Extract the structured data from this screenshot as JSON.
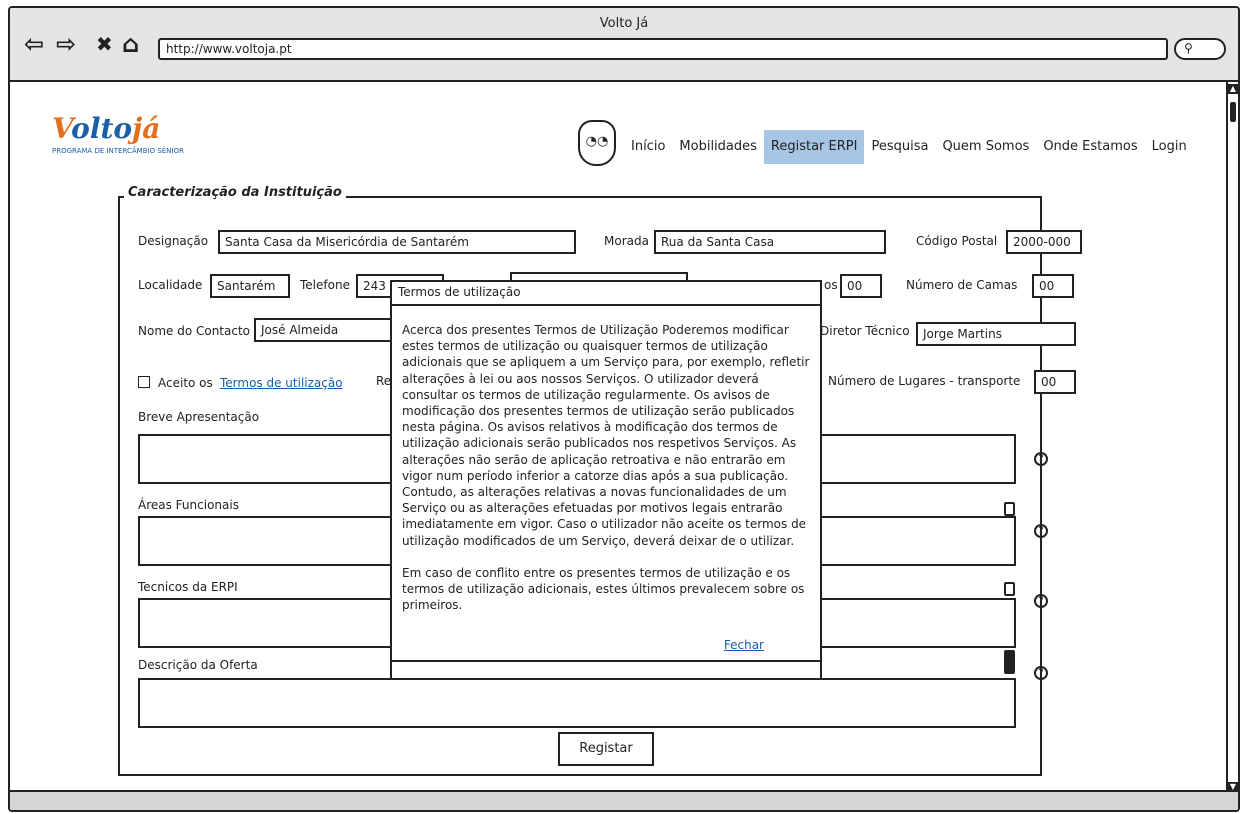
{
  "window": {
    "title": "Volto Já"
  },
  "browser": {
    "back_icon": "⇦",
    "forward_icon": "⇨",
    "close_icon": "✖",
    "home_icon": "⌂",
    "url": "http://www.voltoja.pt",
    "search_icon": "⚲"
  },
  "logo": {
    "main_first": "V",
    "main_rest": "olto",
    "main_end": "já",
    "subtitle": "PROGRAMA DE INTERCÂMBIO SÉNIOR"
  },
  "nav": {
    "items": [
      "Início",
      "Mobilidades",
      "Registar ERPI",
      "Pesquisa",
      "Quem Somos",
      "Onde Estamos",
      "Login"
    ],
    "active": "Registar ERPI"
  },
  "form": {
    "legend": "Caracterização da Instituição",
    "designacao_label": "Designação",
    "designacao_value": "Santa Casa da Misericórdia de Santarém",
    "morada_label": "Morada",
    "morada_value": "Rua da Santa Casa",
    "codigo_postal_label": "Código Postal",
    "codigo_postal_value": "2000-000",
    "localidade_label": "Localidade",
    "localidade_value": "Santarém",
    "telefone_label": "Telefone",
    "telefone_value": "243",
    "quartos_label_partial": "os",
    "quartos_value": "00",
    "camas_label": "Número de Camas",
    "camas_value": "00",
    "contacto_label": "Nome do Contacto",
    "contacto_value": "José Almeida",
    "diretor_label": "Diretor Técnico",
    "diretor_value": "Jorge Martins",
    "aceito_label": "Aceito os",
    "termos_link": "Termos de utilização",
    "re_partial": "Re",
    "lugares_label": "Número de Lugares - transporte",
    "lugares_value": "00",
    "apresentacao_label": "Breve Apresentação",
    "areas_label": "Áreas Funcionais",
    "tecnicos_label": "Tecnicos da ERPI",
    "oferta_label": "Descrição da Oferta",
    "help_icon": "?",
    "submit": "Registar"
  },
  "modal": {
    "title": "Termos de utilização",
    "paragraph1": "Acerca dos presentes Termos de Utilização Poderemos modificar estes termos de utilização ou quaisquer termos de utilização adicionais que se apliquem a um Serviço para, por exemplo, refletir alterações à lei ou aos nossos Serviços. O utilizador deverá consultar os termos de utilização regularmente. Os avisos de modificação dos presentes termos de utilização serão publicados nesta página. Os avisos relativos à modificação dos termos de utilização adicionais serão publicados nos respetivos Serviços. As alterações não serão de aplicação retroativa e não entrarão em vigor num período inferior a catorze dias após a sua publicação. Contudo, as alterações relativas a novas funcionalidades de um Serviço ou as alterações efetuadas por motivos legais entrarão imediatamente em vigor. Caso o utilizador não aceite os termos de utilização modificados de um Serviço, deverá deixar de o utilizar.",
    "paragraph2": "Em caso de conflito entre os presentes termos de utilização e os termos de utilização adicionais, estes últimos prevalecem sobre os primeiros.",
    "close": "Fechar"
  }
}
